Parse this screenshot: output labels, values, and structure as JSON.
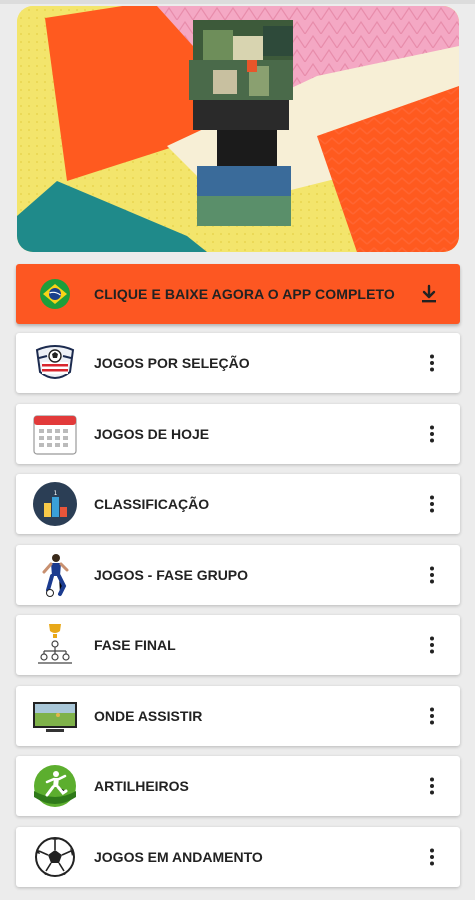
{
  "colors": {
    "accent": "#fd5722",
    "card_background": "#ffffff",
    "page_background": "#ececec",
    "text": "#222222"
  },
  "banner": {
    "icon": "world-cup-trophy-banner"
  },
  "promo": {
    "label": "CLIQUE E BAIXE AGORA O APP COMPLETO",
    "flag_icon": "brazil-flag-icon",
    "action_icon": "download-icon"
  },
  "menu": {
    "items": [
      {
        "label": "JOGOS POR SELEÇÃO",
        "icon": "team-crest-icon"
      },
      {
        "label": "JOGOS DE HOJE",
        "icon": "calendar-icon"
      },
      {
        "label": "CLASSIFICAÇÃO",
        "icon": "ranking-chart-icon"
      },
      {
        "label": "JOGOS - FASE GRUPO",
        "icon": "soccer-player-icon"
      },
      {
        "label": "FASE FINAL",
        "icon": "tournament-bracket-icon"
      },
      {
        "label": "ONDE ASSISTIR",
        "icon": "tv-icon"
      },
      {
        "label": "ARTILHEIROS",
        "icon": "striker-icon"
      },
      {
        "label": "JOGOS EM ANDAMENTO",
        "icon": "soccer-ball-icon"
      }
    ],
    "more_icon": "more-vertical-icon"
  }
}
